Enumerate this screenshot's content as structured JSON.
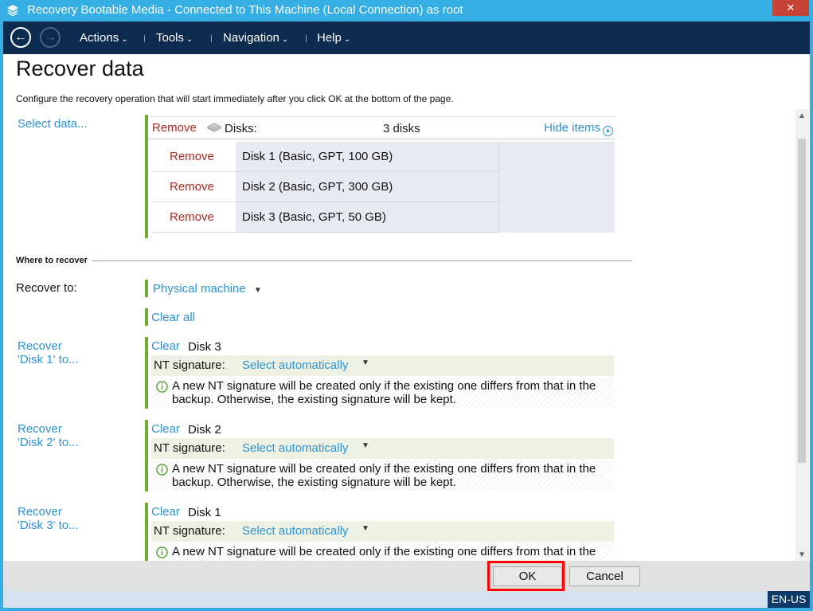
{
  "window": {
    "title": "Recovery Bootable Media - Connected to This Machine (Local Connection) as root",
    "close_glyph": "✕"
  },
  "nav": {
    "back_glyph": "←",
    "forward_glyph": "→",
    "menus": [
      "Actions",
      "Tools",
      "Navigation",
      "Help"
    ],
    "caret": "⌄"
  },
  "page": {
    "title": "Recover data",
    "intro": "Configure the recovery operation that will start immediately after you click OK at the bottom of the page."
  },
  "select_data": {
    "link": "Select data...",
    "remove_all": "Remove",
    "disks_label": "Disks:",
    "disks_count": "3 disks",
    "hide_items": "Hide items",
    "rows": [
      {
        "action": "Remove",
        "name": "Disk 1 (Basic, GPT, 100 GB)"
      },
      {
        "action": "Remove",
        "name": "Disk 2 (Basic, GPT, 300 GB)"
      },
      {
        "action": "Remove",
        "name": "Disk 3 (Basic, GPT, 50 GB)"
      }
    ]
  },
  "where_to_recover": {
    "section_label": "Where to recover",
    "recover_to_label": "Recover to:",
    "recover_to_value": "Physical machine",
    "clear_all": "Clear all",
    "mappings": [
      {
        "source_line1": "Recover",
        "source_line2": "'Disk 1' to...",
        "clear": "Clear",
        "target": "Disk 3",
        "nt_label": "NT signature:",
        "nt_value": "Select automatically",
        "info_line1": "A new NT signature will be created only if the existing one differs from that in the",
        "info_line2": "backup. Otherwise, the existing signature will be kept."
      },
      {
        "source_line1": "Recover",
        "source_line2": "'Disk 2' to...",
        "clear": "Clear",
        "target": "Disk 2",
        "nt_label": "NT signature:",
        "nt_value": "Select automatically",
        "info_line1": "A new NT signature will be created only if the existing one differs from that in the",
        "info_line2": "backup. Otherwise, the existing signature will be kept."
      },
      {
        "source_line1": "Recover",
        "source_line2": "'Disk 3' to...",
        "clear": "Clear",
        "target": "Disk 1",
        "nt_label": "NT signature:",
        "nt_value": "Select automatically",
        "info_line1": "A new NT signature will be created only if the existing one differs from that in the",
        "info_line2": ""
      }
    ]
  },
  "footer": {
    "ok": "OK",
    "cancel": "Cancel"
  },
  "status": {
    "language": "EN-US"
  },
  "colors": {
    "titlebar": "#35aee3",
    "navbar": "#0d2a4f",
    "link": "#2e93d4",
    "remove": "#b0271f",
    "accent_bar": "#6fae35",
    "highlight": "#ff0000"
  }
}
